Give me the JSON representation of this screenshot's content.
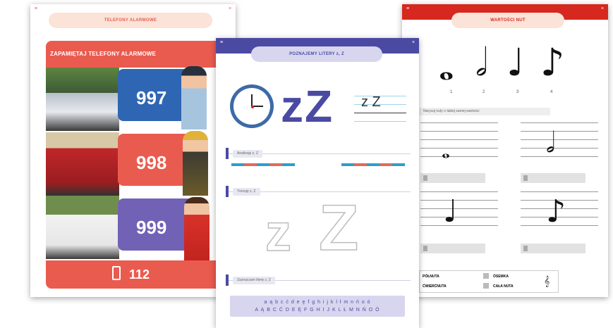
{
  "left_sheet": {
    "header_title": "TELEFONY ALARMOWE",
    "banner": "ZAPAMIĘTAJ TELEFONY ALARMOWE",
    "numbers": [
      "997",
      "998",
      "999"
    ],
    "footer_number": "112",
    "colors": {
      "accent": "#ea5b4f",
      "police": "#2f66b3",
      "fire": "#ea5b4f",
      "ambulance": "#7162b6"
    }
  },
  "middle_sheet": {
    "header_title": "POZNAJEMY LITERY z, Z",
    "big_letters": "zZ",
    "small_letters": "z Z",
    "section_1": "Analizuję z, Z",
    "section_2": "Trenuję z, Z",
    "trace_letters": [
      "z",
      "Z"
    ],
    "section_3": "Zaznaczam literę z, Z",
    "alphabet_lower": "a ą b c ć d e ę f g h i j k l ł m n ń o ó",
    "alphabet_upper": "A Ą B C Ć D E Ę F G H I J K L Ł M N Ń O Ó",
    "colors": {
      "accent": "#4b4aa3"
    }
  },
  "right_sheet": {
    "header_title": "WARTOŚCI NUT",
    "note_numbers": [
      "1",
      "2",
      "3",
      "4"
    ],
    "instruction": "Narysuj nuty o takiej samej wartości",
    "bottom_labels": [
      "PÓŁNUTA",
      "ĆWIERĆNUTA",
      "ÓSEMKA",
      "CAŁA NUTA"
    ],
    "colors": {
      "accent": "#d6281e"
    }
  }
}
